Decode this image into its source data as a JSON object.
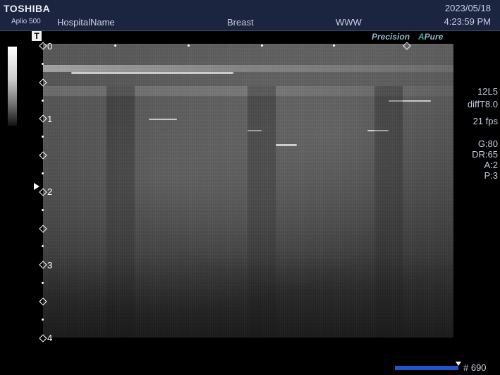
{
  "header": {
    "brand": "TOSHIBA",
    "model": "Aplio 500",
    "hospital": "HospitalName",
    "exam": "Breast",
    "www": "WWW",
    "date": "2023/05/18",
    "time": "4:23:59 PM"
  },
  "overlay": {
    "t_marker": "T",
    "precision": "Precision",
    "apure_a": "A",
    "apure_rest": "Pure"
  },
  "depth_scale": {
    "labels": [
      "0",
      "1",
      "2",
      "3",
      "4"
    ]
  },
  "params": {
    "probe": "12L5",
    "mode": "diffT8.0",
    "fps": "21 fps",
    "gain": "G:80",
    "dr": "DR:65",
    "a": "A:2",
    "p": "P:3"
  },
  "cine": {
    "frame": "# 690"
  },
  "colors": {
    "header_bg": "#1c2540",
    "cine_bar": "#1f55c8",
    "apure_accent": "#2fb3a6"
  }
}
